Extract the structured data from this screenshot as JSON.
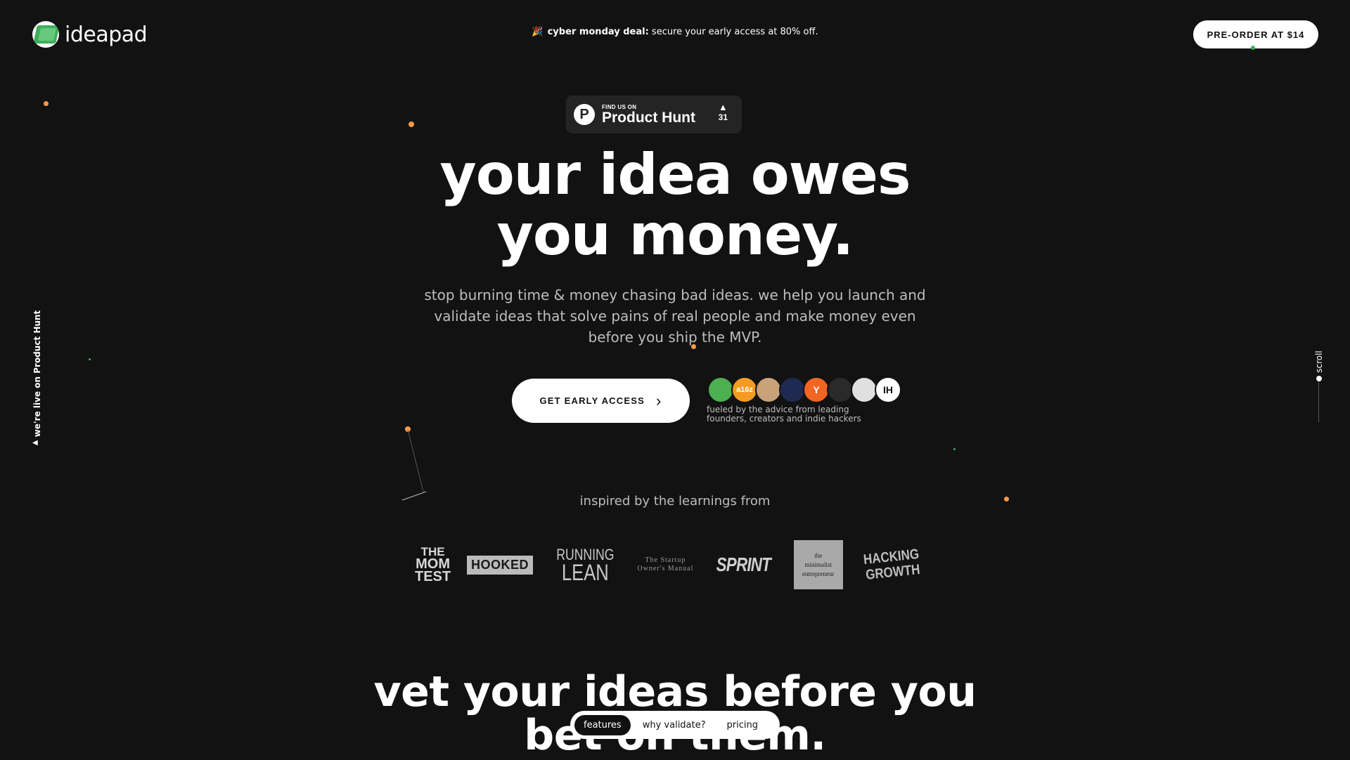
{
  "header": {
    "logo_text": "ideapad",
    "promo_bold": "cyber monday deal:",
    "promo_text": " secure your early access at 80% off.",
    "preorder_label": "PRE-ORDER AT $14"
  },
  "product_hunt": {
    "small": "FIND US ON",
    "big": "Product Hunt",
    "arrow": "▲",
    "count": "31",
    "logo_letter": "P"
  },
  "hero": {
    "line1": "your idea owes",
    "line2": "you money.",
    "subtitle": "stop burning time & money chasing bad ideas. we help you launch and validate ideas that solve pains of real people and make money even before you ship the MVP.",
    "cta_label": "GET EARLY ACCESS",
    "cta_icon": "chevron-right-icon",
    "fueled_line1": "fueled by the advice from leading",
    "fueled_line2": "founders, creators and indie hackers"
  },
  "avatars": [
    {
      "label": "",
      "color": "#4caf50"
    },
    {
      "label": "a16z",
      "color": "#f39c21"
    },
    {
      "label": "",
      "color": "#c9a27a"
    },
    {
      "label": "",
      "color": "#1e2a52"
    },
    {
      "label": "Y",
      "color": "#f26522"
    },
    {
      "label": "",
      "color": "#2a2a2a"
    },
    {
      "label": "",
      "color": "#e0e0e0"
    },
    {
      "label": "IH",
      "color": "#ffffff"
    }
  ],
  "inspired": {
    "label": "inspired by the learnings from",
    "books": {
      "mom_test": [
        "THE",
        "MOM",
        "TEST"
      ],
      "hooked": "HOOKED",
      "running_lean": [
        "RUNNING",
        "LEAN"
      ],
      "startup_manual": [
        "The Startup",
        "Owner's Manual"
      ],
      "sprint": "SPRINT",
      "minimalist": [
        "the",
        "minimalist",
        "entrepreneur"
      ],
      "hacking_growth": [
        "HACKING",
        "GROWTH"
      ]
    }
  },
  "section2": {
    "line1": "vet your ideas before you",
    "line2": "bet on them."
  },
  "floatnav": {
    "items": [
      "features",
      "why validate?",
      "pricing"
    ],
    "active": "features"
  },
  "side": {
    "left_label": "we're live on Product Hunt",
    "right_label": "scroll"
  },
  "colors": {
    "background": "#121212",
    "accent_orange": "#ff9a4a",
    "accent_green": "#3fae5a"
  }
}
